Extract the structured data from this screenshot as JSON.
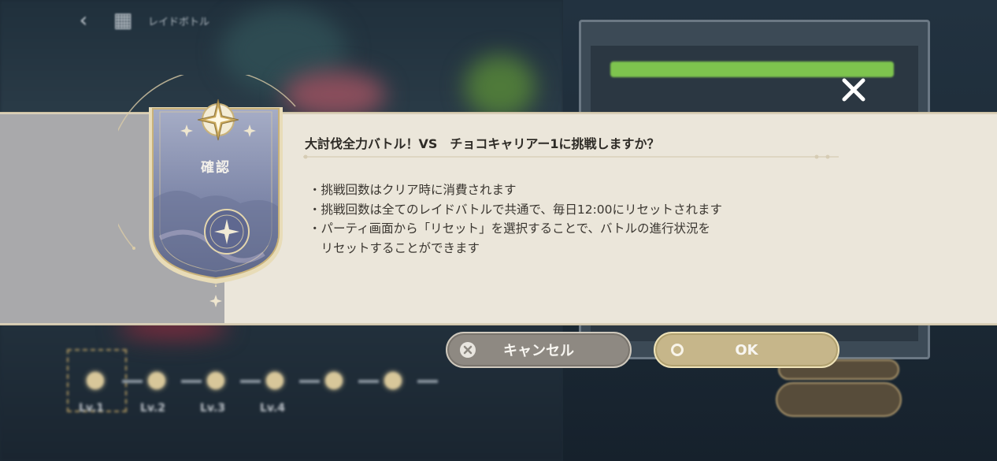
{
  "background": {
    "header_label": "レイドボトル",
    "level_labels": [
      "Lv.1",
      "Lv.2",
      "Lv.3",
      "Lv.4"
    ]
  },
  "dialog": {
    "banner_title": "確認",
    "title": "大討伐全力バトル！VS　チョコキャリアー1に挑戦しますか？",
    "notes": [
      "・挑戦回数はクリア時に消費されます",
      "・挑戦回数は全てのレイドバトルで共通で、毎日12:00にリセットされます",
      "・パーティ画面から「リセット」を選択することで、バトルの進行状況を",
      "　リセットすることができます"
    ],
    "close_icon": "close-x-icon"
  },
  "buttons": {
    "cancel_label": "キャンセル",
    "ok_label": "OK"
  },
  "colors": {
    "band": "#ebe6da",
    "banner_blue": "#7d86a8",
    "gold": "#c9b27a",
    "cancel": "#8e8982",
    "ok": "#c6b68a"
  }
}
